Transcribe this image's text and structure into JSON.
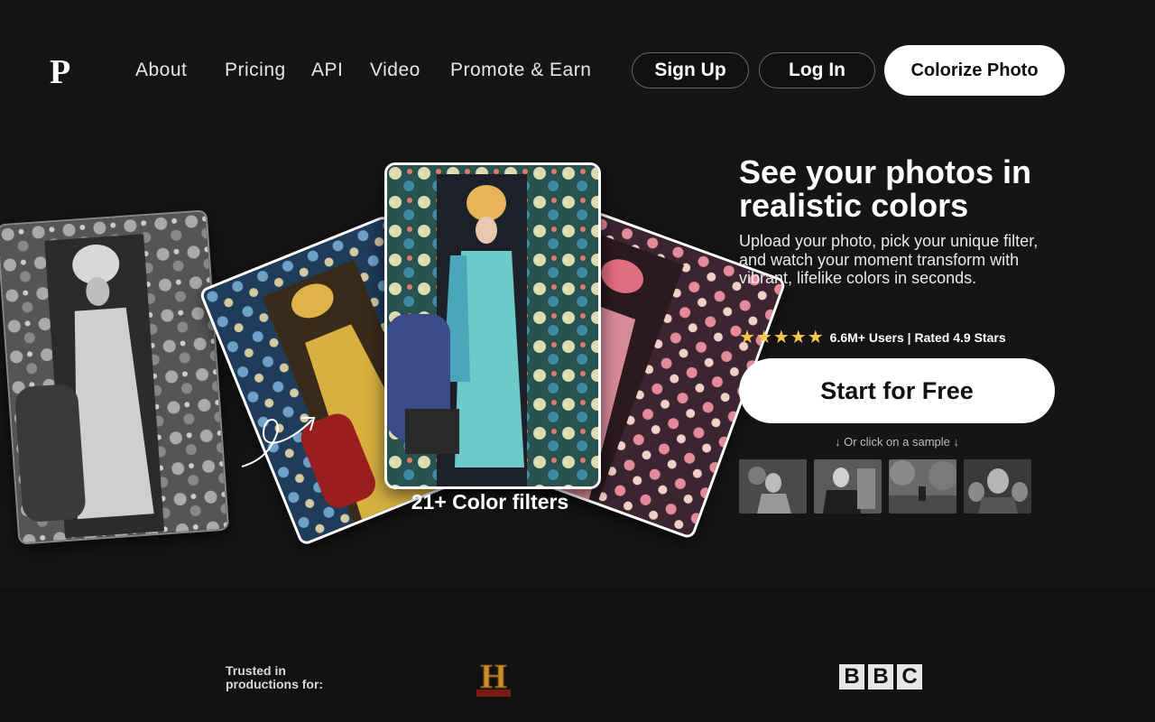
{
  "brand": {
    "logo_letter": "P"
  },
  "nav": {
    "items": [
      "About",
      "Pricing",
      "API",
      "Video",
      "Promote & Earn"
    ],
    "sign_up": "Sign Up",
    "log_in": "Log In",
    "cta": "Colorize Photo"
  },
  "showcase": {
    "filters_caption": "21+ Color filters"
  },
  "hero": {
    "title": "See your photos in realistic colors",
    "subtitle": "Upload your photo, pick your unique filter, and watch your moment transform with vibrant, lifelike colors in seconds.",
    "stars": "★★★★★",
    "rating_text": "6.6M+ Users | Rated 4.9 Stars",
    "start_button": "Start for Free",
    "sample_hint": "↓ Or click on a sample ↓"
  },
  "trust": {
    "label": "Trusted in productions for:",
    "logos": [
      "history-logo",
      "bbc-logo"
    ],
    "history_letter": "H",
    "bbc_letters": [
      "B",
      "B",
      "C"
    ]
  },
  "colors": {
    "background": "#161415",
    "accent_star": "#f5c84c",
    "button_white": "#ffffff"
  }
}
